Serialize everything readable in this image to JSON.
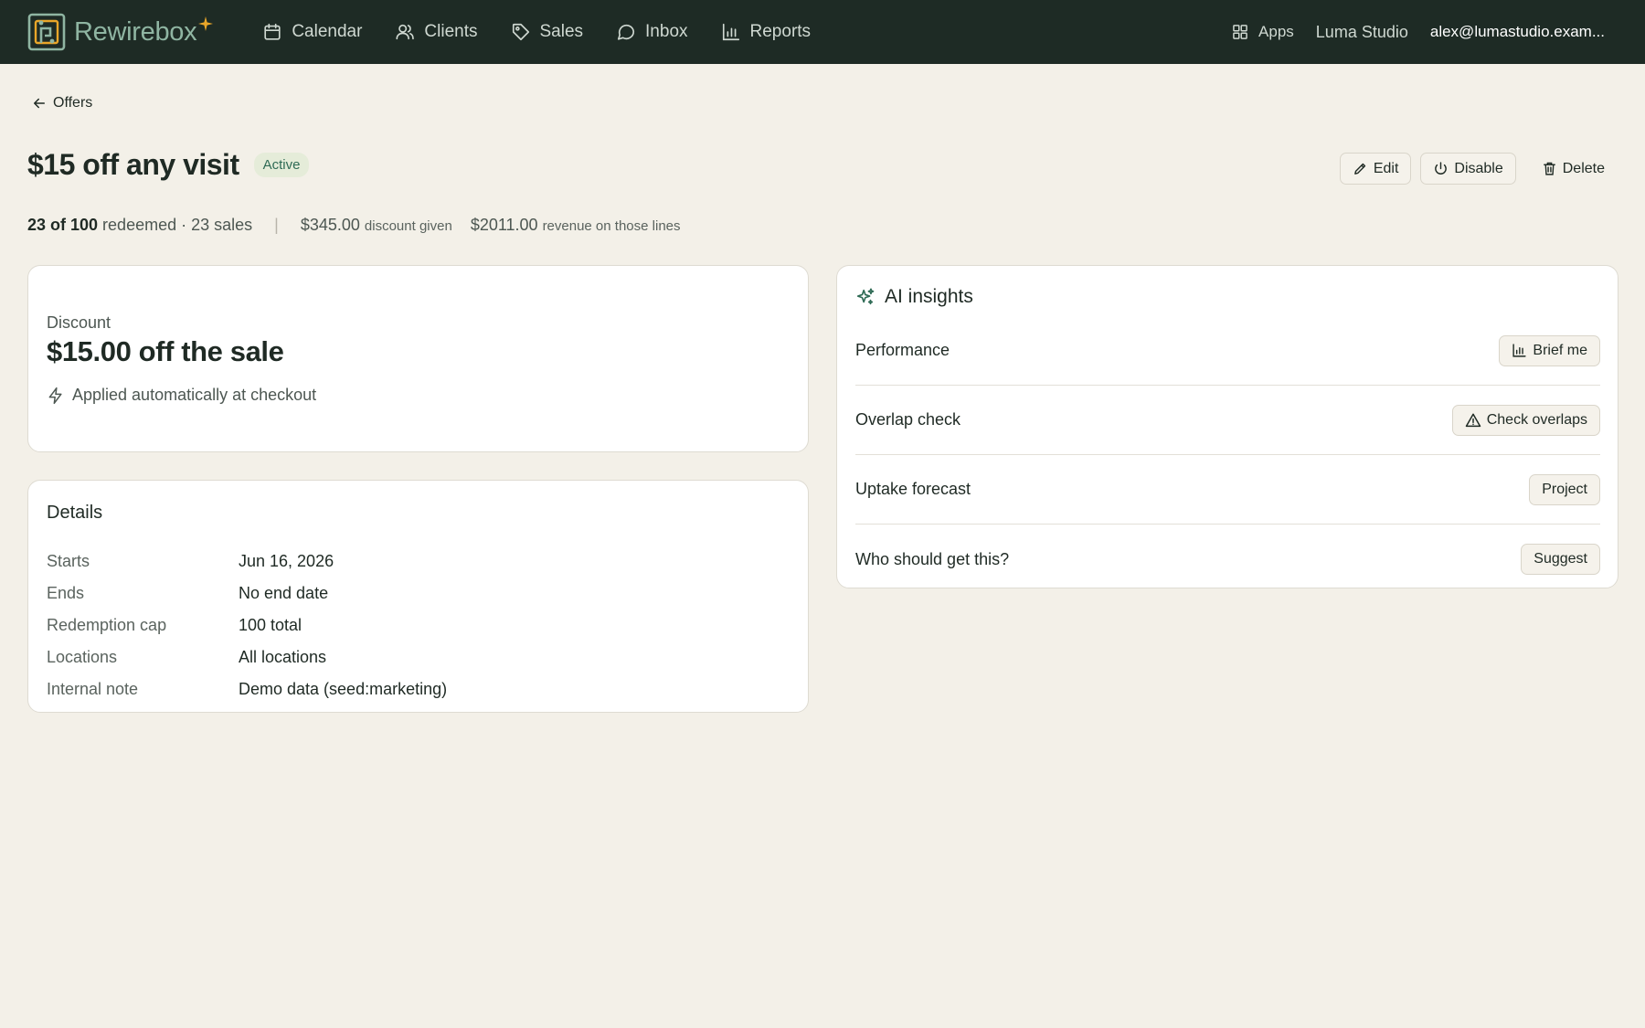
{
  "nav": {
    "brand": "Rewirebox",
    "items": [
      {
        "label": "Calendar",
        "icon": "calendar-icon"
      },
      {
        "label": "Clients",
        "icon": "users-icon"
      },
      {
        "label": "Sales",
        "icon": "tag-icon"
      },
      {
        "label": "Inbox",
        "icon": "message-icon"
      },
      {
        "label": "Reports",
        "icon": "bar-chart-icon"
      }
    ],
    "apps_label": "Apps",
    "studio": "Luma Studio",
    "user_email": "alex@lumastudio.exam..."
  },
  "breadcrumb": {
    "back_label": "Offers"
  },
  "offer": {
    "title": "$15 off any visit",
    "status": "Active",
    "actions": {
      "edit": "Edit",
      "disable": "Disable",
      "delete": "Delete"
    }
  },
  "stats": {
    "redeemed": "23 of 100",
    "redeemed_suffix": "redeemed · 23 sales",
    "discount_amount": "$345.00",
    "discount_label": "discount given",
    "revenue_amount": "$2011.00",
    "revenue_label": "revenue on those lines"
  },
  "discount": {
    "label": "Discount",
    "value": "$15.00 off the sale",
    "note": "Applied automatically at checkout"
  },
  "details": {
    "title": "Details",
    "rows": [
      {
        "key": "Starts",
        "value": "Jun 16, 2026"
      },
      {
        "key": "Ends",
        "value": "No end date"
      },
      {
        "key": "Redemption cap",
        "value": "100 total"
      },
      {
        "key": "Locations",
        "value": "All locations"
      },
      {
        "key": "Internal note",
        "value": "Demo data (seed:marketing)"
      }
    ]
  },
  "ai": {
    "title": "AI insights",
    "rows": [
      {
        "label": "Performance",
        "button": "Brief me"
      },
      {
        "label": "Overlap check",
        "button": "Check overlaps"
      },
      {
        "label": "Uptake forecast",
        "button": "Project"
      },
      {
        "label": "Who should get this?",
        "button": "Suggest"
      }
    ]
  },
  "colors": {
    "topbar": "#1e2b25",
    "background": "#f3f0e8",
    "accent": "#2f6b55",
    "spark": "#e9a629"
  }
}
